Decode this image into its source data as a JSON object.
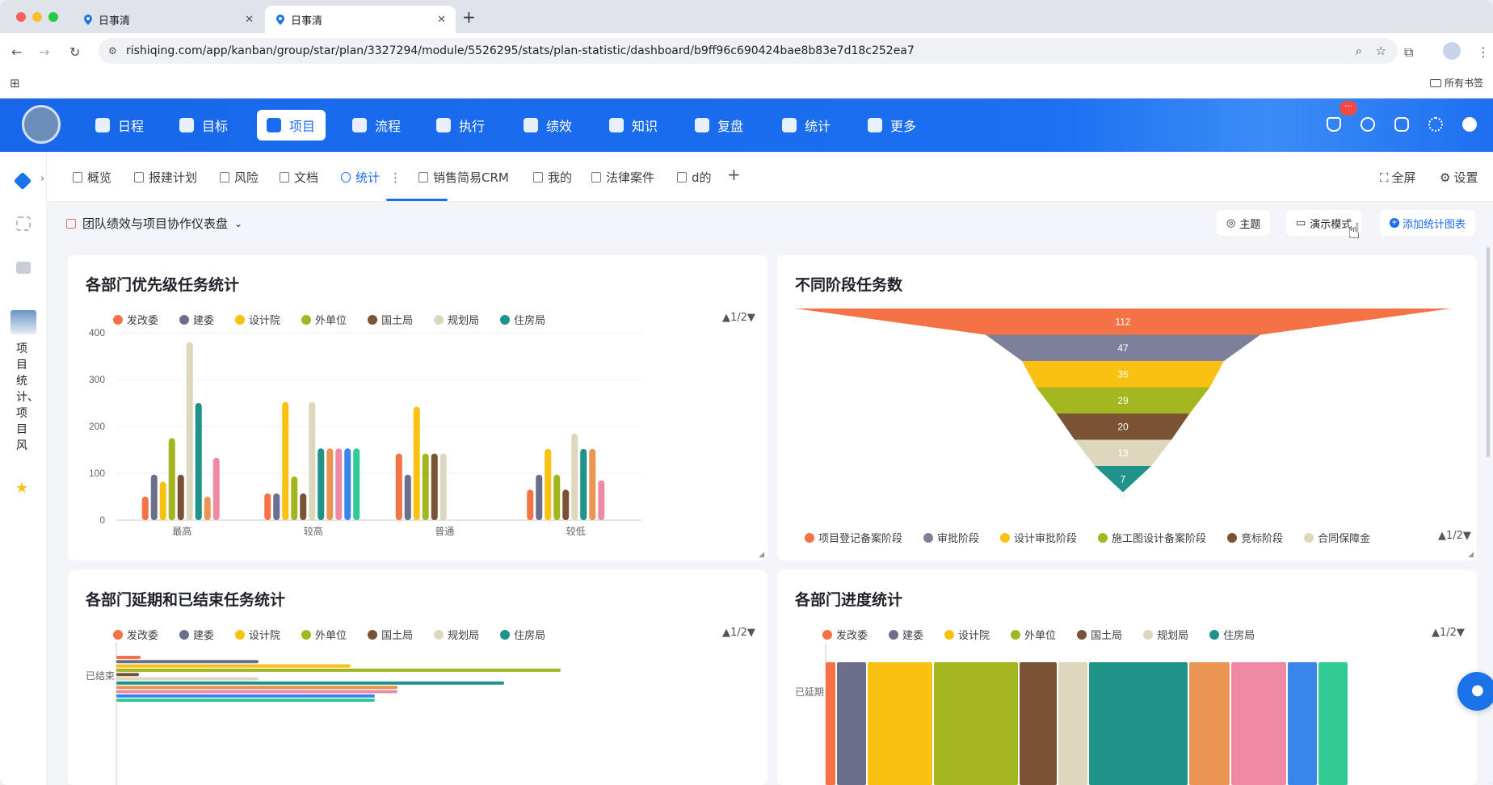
{
  "browser": {
    "tabs": [
      {
        "title": "日事清"
      },
      {
        "title": "日事清"
      }
    ],
    "url": "rishiqing.com/app/kanban/group/star/plan/3327294/module/5526295/stats/plan-statistic/dashboard/b9ff96c690424bae8b83e7d18c252ea7",
    "bookmarks_label": "所有书签"
  },
  "app": {
    "menu": [
      {
        "label": "日程"
      },
      {
        "label": "目标"
      },
      {
        "label": "项目"
      },
      {
        "label": "流程"
      },
      {
        "label": "执行"
      },
      {
        "label": "绩效"
      },
      {
        "label": "知识"
      },
      {
        "label": "复盘"
      },
      {
        "label": "统计"
      },
      {
        "label": "更多"
      }
    ],
    "notification_badge": "···",
    "sidebar_project": "项目统计、项目风"
  },
  "subtabs": [
    {
      "label": "概览"
    },
    {
      "label": "报建计划"
    },
    {
      "label": "风险"
    },
    {
      "label": "文档"
    },
    {
      "label": "统计"
    },
    {
      "label": "销售简易CRM"
    },
    {
      "label": "我的"
    },
    {
      "label": "法律案件"
    },
    {
      "label": "d的"
    }
  ],
  "subtab_actions": {
    "fullscreen": "全屏",
    "settings": "设置"
  },
  "dashboard": {
    "title": "团队绩效与项目协作仪表盘",
    "buttons": {
      "theme": "主题",
      "demo": "演示模式",
      "add": "添加统计图表"
    }
  },
  "colors": {
    "发改委": "#f47245",
    "建委": "#6c6f8c",
    "设计院": "#fac113",
    "外单位": "#a3b61f",
    "国土局": "#7a5234",
    "规划局": "#ddd7bd",
    "住房局": "#1f928a",
    "s8": "#e99655",
    "s9": "#ef8aa4",
    "s10": "#3a86e8",
    "s11": "#2fcb93"
  },
  "chart_data": [
    {
      "type": "bar",
      "title": "各部门优先级任务统计",
      "categories": [
        "最高",
        "较高",
        "普通",
        "较低"
      ],
      "ylim": [
        0,
        400
      ],
      "yticks": [
        0,
        100,
        200,
        300,
        400
      ],
      "legend": [
        "发改委",
        "建委",
        "设计院",
        "外单位",
        "国土局",
        "规划局",
        "住房局"
      ],
      "legend_page": "1/2",
      "series_colors": [
        "#f47245",
        "#6c6f8c",
        "#fac113",
        "#a3b61f",
        "#7a5234",
        "#ddd7bd",
        "#1f928a",
        "#e99655",
        "#ef8aa4",
        "#3a86e8",
        "#2fcb93"
      ],
      "values": [
        [
          50,
          97,
          82,
          175,
          97,
          380,
          250,
          50,
          133,
          null,
          null
        ],
        [
          57,
          57,
          252,
          93,
          57,
          252,
          153,
          153,
          153,
          153,
          153
        ],
        [
          142,
          97,
          242,
          142,
          142,
          142,
          0,
          0,
          0,
          0,
          0
        ],
        [
          65,
          97,
          152,
          97,
          65,
          185,
          152,
          152,
          85,
          0,
          0
        ]
      ]
    },
    {
      "type": "funnel",
      "title": "不同阶段任务数",
      "values": [
        112,
        47,
        35,
        29,
        20,
        13,
        7,
        0
      ],
      "colors": [
        "#f47245",
        "#7d809b",
        "#fac113",
        "#a3b61f",
        "#7a5234",
        "#ddd7bd",
        "#1f928a",
        "#e99655"
      ],
      "legend": [
        "项目登记备案阶段",
        "审批阶段",
        "设计审批阶段",
        "施工图设计备案阶段",
        "竞标阶段",
        "合同保障金"
      ],
      "legend_page": "1/2"
    },
    {
      "type": "bar",
      "title": "各部门延期和已结束任务统计",
      "categories": [
        "已结束"
      ],
      "legend": [
        "发改委",
        "建委",
        "设计院",
        "外单位",
        "国土局",
        "规划局",
        "住房局"
      ],
      "legend_page": "1/2"
    },
    {
      "type": "bar",
      "title": "各部门进度统计",
      "categories": [
        "已延期"
      ],
      "legend": [
        "发改委",
        "建委",
        "设计院",
        "外单位",
        "国土局",
        "规划局",
        "住房局"
      ],
      "legend_page": "1/2"
    }
  ]
}
